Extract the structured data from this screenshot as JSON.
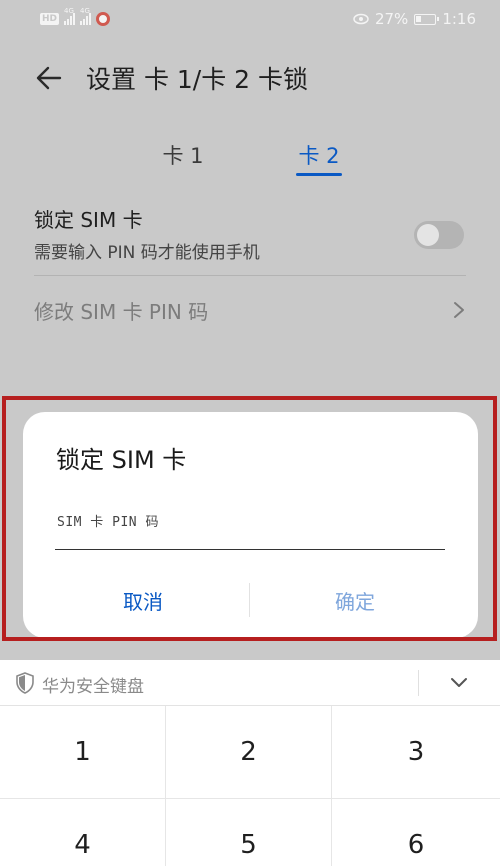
{
  "status_bar": {
    "network_badge": "HD",
    "signal_1": "4G",
    "signal_2": "4G",
    "battery": "27%",
    "time": "1:16"
  },
  "header": {
    "title": "设置 卡 1/卡 2 卡锁",
    "back_icon": "arrow-left-icon"
  },
  "tabs": [
    {
      "label": "卡 1",
      "selected": false
    },
    {
      "label": "卡 2",
      "selected": true
    }
  ],
  "settings": {
    "lock_sim": {
      "title": "锁定 SIM 卡",
      "subtitle": "需要输入 PIN 码才能使用手机",
      "enabled": false
    },
    "change_pin": {
      "title": "修改 SIM 卡 PIN 码"
    }
  },
  "dialog": {
    "title": "锁定 SIM 卡",
    "input_placeholder": "SIM 卡 PIN 码",
    "input_value": "",
    "cancel_label": "取消",
    "confirm_label": "确定"
  },
  "keyboard": {
    "name": "华为安全键盘",
    "keys": [
      "1",
      "2",
      "3",
      "4",
      "5",
      "6"
    ]
  },
  "colors": {
    "accent": "#0a59c4",
    "highlight_border": "#b61f1f",
    "overlay_background": "#c9c9c9"
  }
}
